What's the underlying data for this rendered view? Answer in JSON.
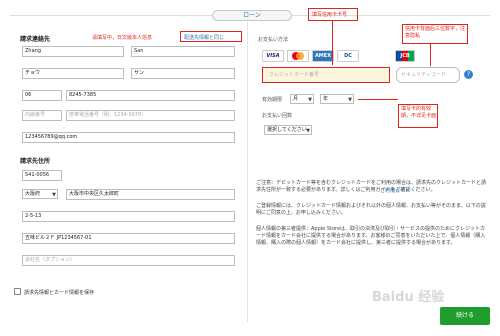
{
  "tab_label": "ローン",
  "billing_contact": {
    "title": "請求連絡先",
    "first_name": "Zhang",
    "last_name": "San",
    "first_kana": "チョウ",
    "last_kana": "サン",
    "phone_area": "06",
    "phone_number": "8245-7385",
    "ext_placeholder": "内線番号",
    "mobile_placeholder": "携帯電話番号（例：1234-5678）",
    "email": "123456789@qq.com"
  },
  "billing_address": {
    "title": "請求先住所",
    "postal": "541-0056",
    "prefecture": "大阪府",
    "city": "大阪市中央区久太郎町",
    "street": "2-5-13",
    "building": "五味ビル２Ｆ JP1234567-01",
    "company_placeholder": "会社名（オプション）"
  },
  "payment": {
    "title": "お支払い方法",
    "card_brands": [
      "VISA",
      "MC",
      "AMEX",
      "DC",
      "JCB"
    ],
    "card_number_placeholder": "クレジットカード番号",
    "security_placeholder": "セキュリティコード",
    "help_icon": "?",
    "expiry_label": "有効期限",
    "month_value": "月",
    "year_value": "年",
    "installments_label": "お支払い回数",
    "installments_value": "選択してください"
  },
  "annotations": {
    "same_as_contact_callout": "配送先情報と同じ",
    "fill_name_note": "请填写中，日文版本人信息",
    "card_number_note": "填写信用卡卡号",
    "security_note": "信用卡背面后三位数字，注意隐私",
    "expiry_note": "填写卡的有效期，不详见卡面"
  },
  "notes": {
    "para1": "ご注意：デビットカード等を含むクレジットカードをご利用の場合は、請求先のクレジットカードと請求先住所が一致する必要があります。詳しくはご利用ガイドをご確認ください。",
    "link_text": "ご利用ガイド",
    "para2": "ご登録情報には、クレジットカード情報およびそれ以外の個人情報、お支払い等がそのまま、以下の説明にご同意の上、お申し込みください。",
    "para3": "個人情報の第三者提供：Apple Storeは、取引の決済及び取引・サービスの提供のためにクレジットカード情報をカード会社に提供する場合があります。お客様のご同意をいただいた上で、個人情報（購入情報、購入の際の個人情報）をカード会社に提供し、第三者に提供する場合があります。"
  },
  "save_checkbox_label": "請求先情報とカード情報を保存",
  "continue_button": "続ける",
  "watermark": "Baidu 经验"
}
